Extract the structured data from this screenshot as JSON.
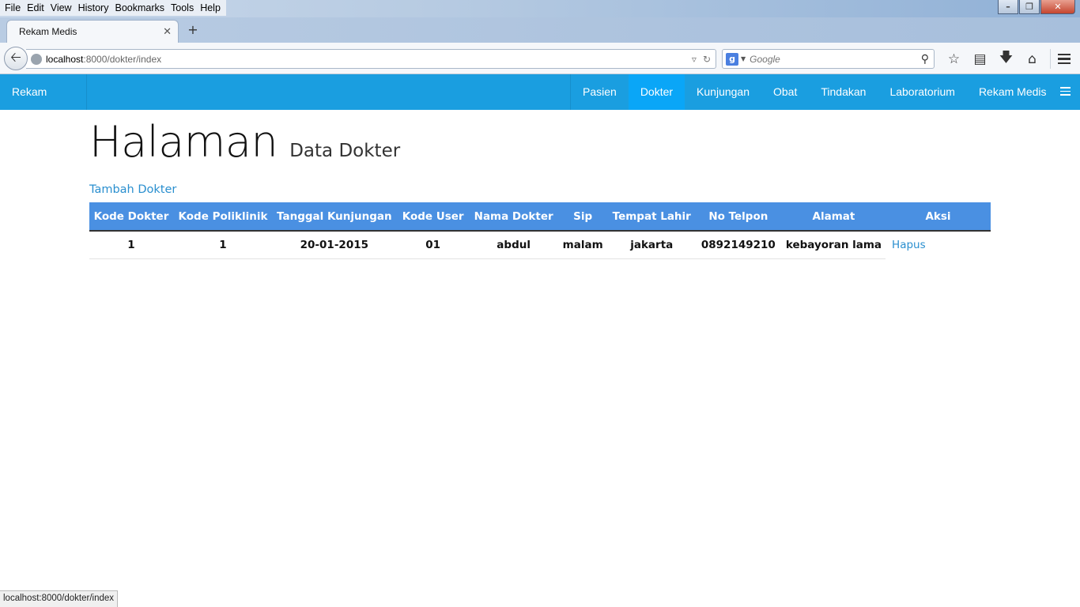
{
  "browser": {
    "menu": [
      "File",
      "Edit",
      "View",
      "History",
      "Bookmarks",
      "Tools",
      "Help"
    ],
    "tab_title": "Rekam Medis",
    "url_host": "localhost",
    "url_rest": ":8000/dokter/index",
    "search_placeholder": "Google",
    "status_url": "localhost:8000/dokter/index"
  },
  "app": {
    "brand": "Rekam Medis",
    "nav": [
      {
        "label": "Pasien",
        "active": false
      },
      {
        "label": "Dokter",
        "active": true
      },
      {
        "label": "Kunjungan",
        "active": false
      },
      {
        "label": "Obat",
        "active": false
      },
      {
        "label": "Tindakan",
        "active": false
      },
      {
        "label": "Laboratorium",
        "active": false
      },
      {
        "label": "Rekam Medis",
        "active": false
      }
    ]
  },
  "page": {
    "title": "Halaman",
    "subtitle": "Data Dokter",
    "add_link": "Tambah Dokter"
  },
  "table": {
    "headers": [
      "Kode Dokter",
      "Kode Poliklinik",
      "Tanggal Kunjungan",
      "Kode User",
      "Nama Dokter",
      "Sip",
      "Tempat Lahir",
      "No Telpon",
      "Alamat",
      "Aksi"
    ],
    "rows": [
      {
        "cells": [
          "1",
          "1",
          "20-01-2015",
          "01",
          "abdul",
          "malam",
          "jakarta",
          "0892149210",
          "kebayoran lama"
        ],
        "action": "Hapus"
      }
    ]
  },
  "colors": {
    "navbar": "#1a9ee0",
    "nav_active": "#0aa6f7",
    "table_header": "#4a90e2",
    "link": "#2a8fcf"
  }
}
